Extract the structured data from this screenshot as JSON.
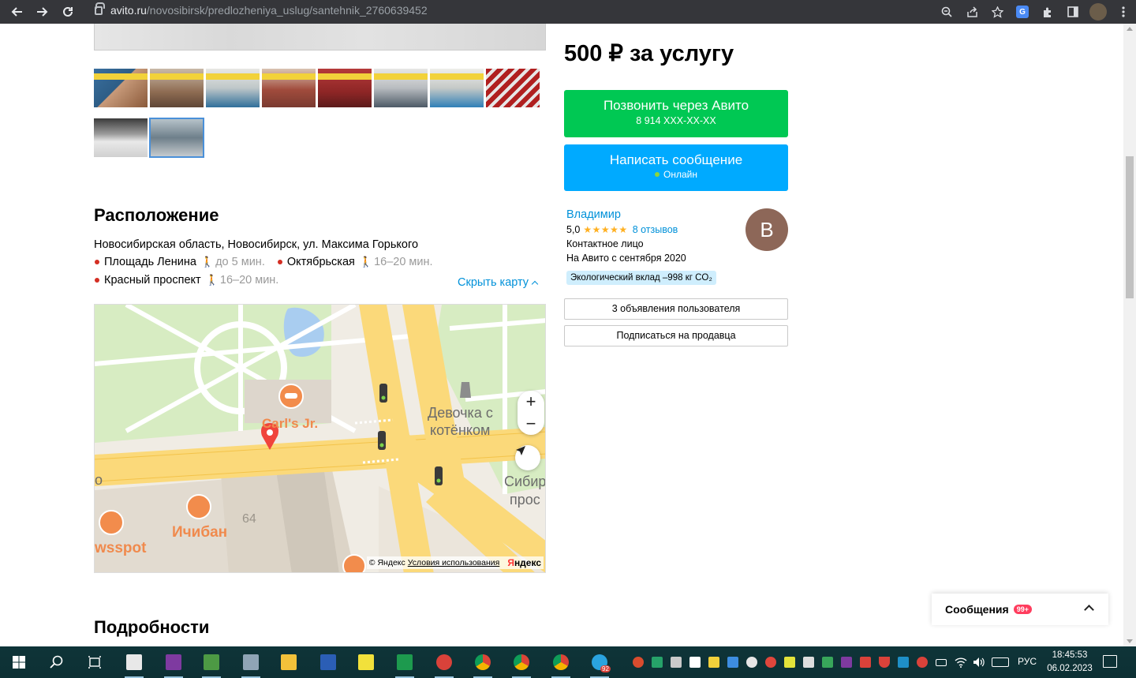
{
  "browser": {
    "url_host": "avito.ru",
    "url_path": "/novosibirsk/predlozheniya_uslug/santehnik_2760639452"
  },
  "location": {
    "heading": "Расположение",
    "address": "Новосибирская область, Новосибирск, ул. Максима Горького",
    "metro": [
      {
        "name": "Площадь Ленина",
        "time": "до 5 мин."
      },
      {
        "name": "Октябрьская",
        "time": "16–20 мин."
      },
      {
        "name": "Красный проспект",
        "time": "16–20 мин."
      }
    ],
    "hide_map": "Скрыть карту"
  },
  "map": {
    "labels": {
      "carls": "Carl's Jr.",
      "statue_1": "Девочка с",
      "statue_2": "котёнком",
      "ichiban": "Ичибан",
      "wsspot": "wsspot",
      "house": "64",
      "sib_1": "Сибир",
      "sib_2": "прос",
      "o": "о"
    },
    "zoom_in": "+",
    "zoom_out": "−",
    "copyright": "© Яндекс",
    "terms": "Условия использования",
    "logo_y": "Я",
    "logo_rest": "ндекс"
  },
  "details": {
    "heading": "Подробности"
  },
  "sidebar": {
    "price": "500 ₽ за услугу",
    "call_label": "Позвонить через Авито",
    "call_phone": "8 914 XXX-XX-XX",
    "message_label": "Написать сообщение",
    "online": "Онлайн",
    "seller_name": "Владимир",
    "rating": "5,0",
    "stars": "★★★★★",
    "reviews": "8 отзывов",
    "seller_type": "Контактное лицо",
    "since": "На Авито с сентября 2020",
    "eco": "Экологический вклад –998 кг CO₂",
    "avatar_letter": "В",
    "listings_btn": "3 объявления пользователя",
    "subscribe_btn": "Подписаться на продавца"
  },
  "messages_widget": {
    "title": "Сообщения",
    "badge": "99+"
  },
  "taskbar": {
    "telegram_badge": "92",
    "lang": "РУС",
    "time": "18:45:53",
    "date": "06.02.2023"
  },
  "colors": {
    "call_green": "#00c853",
    "msg_blue": "#00aaff",
    "link_blue": "#0091d9",
    "metro_red": "#d42e23"
  }
}
